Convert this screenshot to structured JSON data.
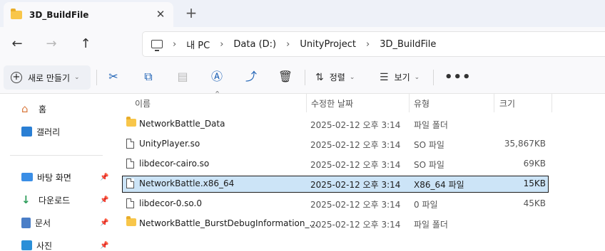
{
  "tab": {
    "title": "3D_BuildFile",
    "close": "✕",
    "new": "+"
  },
  "nav": {
    "back": "←",
    "forward": "→",
    "up": "↑"
  },
  "breadcrumb": [
    "내 PC",
    "Data (D:)",
    "UnityProject",
    "3D_BuildFile"
  ],
  "breadcrumb_separator": "›",
  "toolbar": {
    "new_label": "새로 만들기",
    "sort_label": "정렬",
    "view_label": "보기",
    "more": "•••"
  },
  "sidebar": {
    "items": [
      {
        "label": "홈",
        "icon": "home-icon"
      },
      {
        "label": "갤러리",
        "icon": "gallery-icon"
      },
      {
        "label": "바탕 화면",
        "icon": "desktop-icon",
        "pinned": true
      },
      {
        "label": "다운로드",
        "icon": "download-icon",
        "pinned": true
      },
      {
        "label": "문서",
        "icon": "document-icon",
        "pinned": true
      },
      {
        "label": "사진",
        "icon": "pictures-icon",
        "pinned": true
      }
    ]
  },
  "columns": {
    "name": "이름",
    "date": "수정한 날짜",
    "type": "유형",
    "size": "크기"
  },
  "files": [
    {
      "name": "NetworkBattle_Data",
      "date": "2025-02-12 오후 3:14",
      "type": "파일 폴더",
      "size": "",
      "kind": "folder"
    },
    {
      "name": "UnityPlayer.so",
      "date": "2025-02-12 오후 3:14",
      "type": "SO 파일",
      "size": "35,867KB",
      "kind": "file"
    },
    {
      "name": "libdecor-cairo.so",
      "date": "2025-02-12 오후 3:14",
      "type": "SO 파일",
      "size": "69KB",
      "kind": "file"
    },
    {
      "name": "NetworkBattle.x86_64",
      "date": "2025-02-12 오후 3:14",
      "type": "X86_64 파일",
      "size": "15KB",
      "kind": "file",
      "selected": true
    },
    {
      "name": "libdecor-0.so.0",
      "date": "2025-02-12 오후 3:14",
      "type": "0 파일",
      "size": "45KB",
      "kind": "file"
    },
    {
      "name": "NetworkBattle_BurstDebugInformation_...",
      "date": "2025-02-12 오후 3:14",
      "type": "파일 폴더",
      "size": "",
      "kind": "folder"
    }
  ],
  "colors": {
    "selection": "#cce4f7",
    "folder": "#f8c64a",
    "accent": "#1a5fb4"
  }
}
